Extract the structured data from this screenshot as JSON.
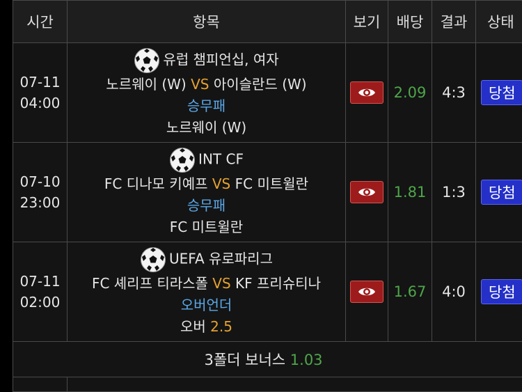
{
  "header": {
    "time": "시간",
    "item": "항목",
    "view": "보기",
    "odds": "배당",
    "result": "결과",
    "status": "상태"
  },
  "rows": [
    {
      "date": "07-11",
      "time": "04:00",
      "league": "유럽 챔피언십, 여자",
      "home": "노르웨이 (W)",
      "vs": "VS",
      "away": "아이슬란드 (W)",
      "bet_type": "승무패",
      "pick": "노르웨이 (W)",
      "pick_extra": "",
      "odds": "2.09",
      "score": "4:3",
      "status": "당첨"
    },
    {
      "date": "07-10",
      "time": "23:00",
      "league": "INT CF",
      "home": "FC 디나모 키예프",
      "vs": "VS",
      "away": "FC 미트윌란",
      "bet_type": "승무패",
      "pick": "FC 미트윌란",
      "pick_extra": "",
      "odds": "1.81",
      "score": "1:3",
      "status": "당첨"
    },
    {
      "date": "07-11",
      "time": "02:00",
      "league": "UEFA 유로파리그",
      "home": "FC 셰리프 티라스폴",
      "vs": "VS",
      "away": "KF 프리슈티나",
      "bet_type": "오버언더",
      "pick": "오버",
      "pick_extra": "2.5",
      "odds": "1.67",
      "score": "4:0",
      "status": "당첨"
    }
  ],
  "bonus": {
    "label": "3폴더 보너스",
    "value": "1.03"
  },
  "colors": {
    "vs": "#e6a230",
    "bet_type": "#5aa8e8",
    "odds": "#4ea64a",
    "status_bg": "#2430c8",
    "view_button": "#9e1b1b"
  },
  "icons": {
    "sport": "soccer-ball-icon",
    "view": "eye-icon"
  }
}
